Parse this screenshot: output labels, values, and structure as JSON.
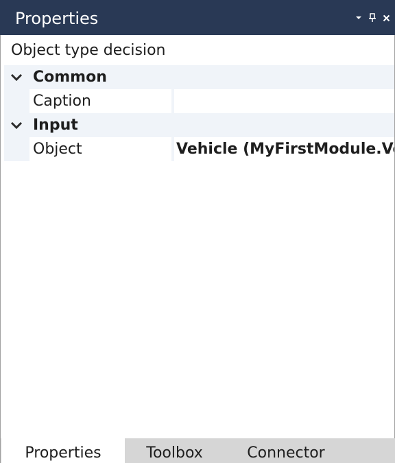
{
  "panel": {
    "title": "Properties",
    "controls": {
      "menu_icon": "chevron-down-icon",
      "pin_icon": "pin-icon",
      "close_icon": "close-icon"
    }
  },
  "object_type": "Object type decision",
  "categories": [
    {
      "label": "Common",
      "properties": [
        {
          "name": "Caption",
          "value": ""
        }
      ]
    },
    {
      "label": "Input",
      "properties": [
        {
          "name": "Object",
          "value": "Vehicle (MyFirstModule.Vehicle)"
        }
      ]
    }
  ],
  "tabs": [
    {
      "label": "Properties",
      "active": true
    },
    {
      "label": "Toolbox",
      "active": false
    },
    {
      "label": "Connector",
      "active": false
    }
  ],
  "colors": {
    "titlebar": "#293955",
    "category_bg": "#f0f4f9",
    "tabstrip": "#d6d6d6"
  }
}
